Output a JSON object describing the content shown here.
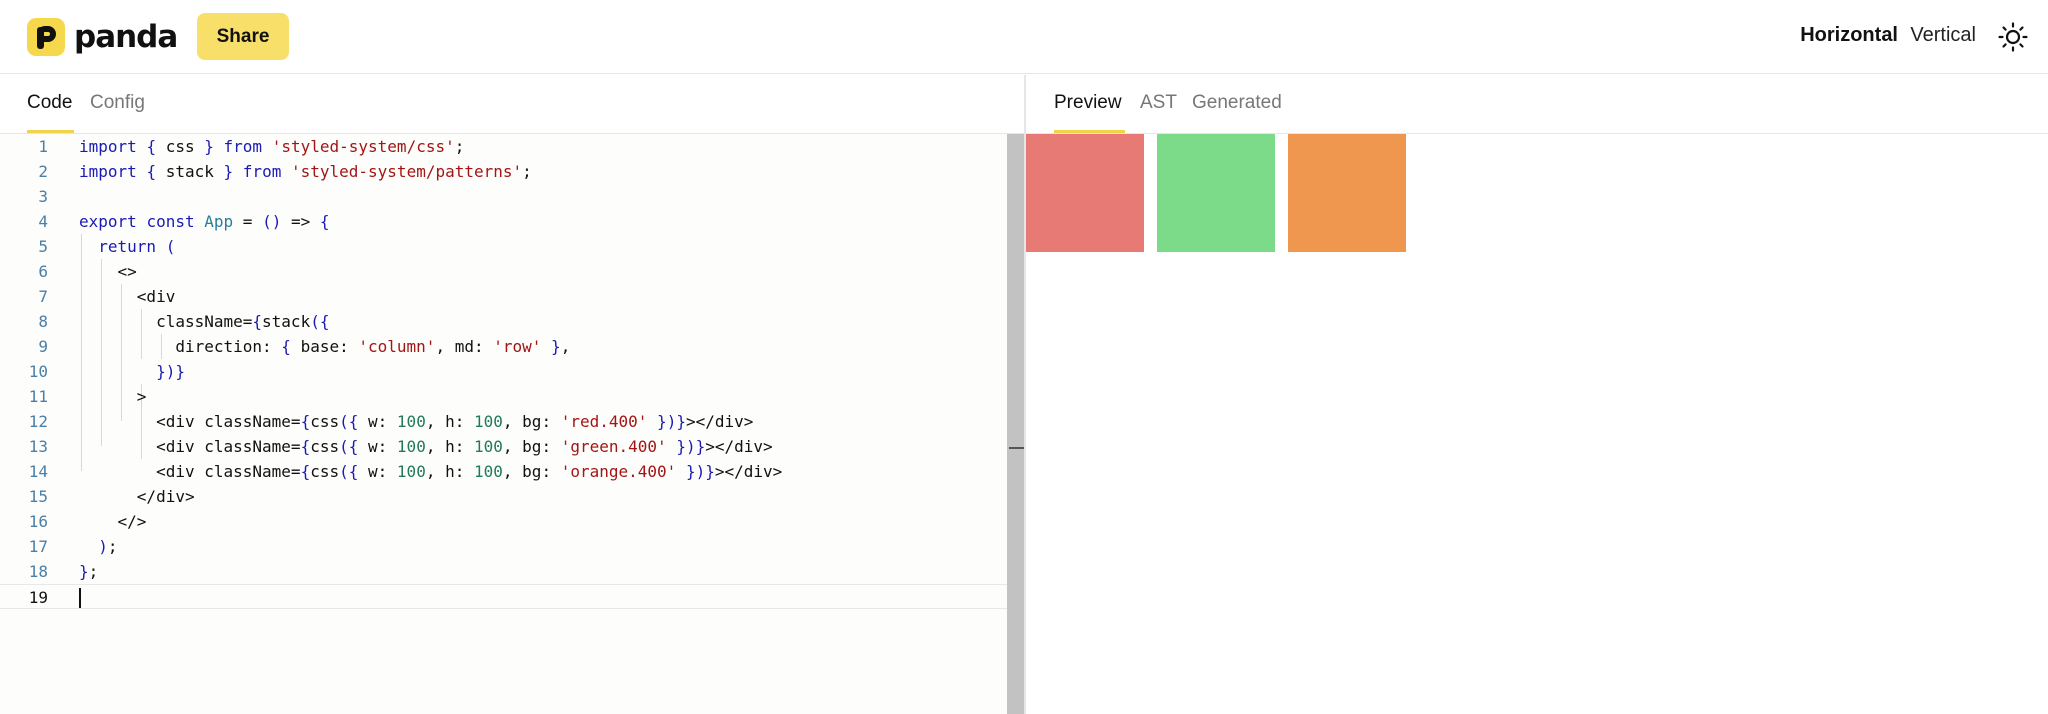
{
  "header": {
    "logo_text": "panda",
    "share_label": "Share",
    "layout_horizontal": "Horizontal",
    "layout_vertical": "Vertical",
    "theme_icon": "sun-icon"
  },
  "editor_tabs": [
    {
      "label": "Code",
      "active": true
    },
    {
      "label": "Config",
      "active": false
    }
  ],
  "preview_tabs": [
    {
      "label": "Preview",
      "active": true
    },
    {
      "label": "AST",
      "active": false
    },
    {
      "label": "Generated",
      "active": false
    }
  ],
  "code_lines": [
    {
      "n": "1",
      "text": "import { css } from 'styled-system/css';"
    },
    {
      "n": "2",
      "text": "import { stack } from 'styled-system/patterns';"
    },
    {
      "n": "3",
      "text": ""
    },
    {
      "n": "4",
      "text": "export const App = () => {"
    },
    {
      "n": "5",
      "text": "  return ("
    },
    {
      "n": "6",
      "text": "    <>"
    },
    {
      "n": "7",
      "text": "      <div"
    },
    {
      "n": "8",
      "text": "        className={stack({"
    },
    {
      "n": "9",
      "text": "          direction: { base: 'column', md: 'row' },"
    },
    {
      "n": "10",
      "text": "        })}"
    },
    {
      "n": "11",
      "text": "      >"
    },
    {
      "n": "12",
      "text": "        <div className={css({ w: 100, h: 100, bg: 'red.400' })}></div>"
    },
    {
      "n": "13",
      "text": "        <div className={css({ w: 100, h: 100, bg: 'green.400' })}></div>"
    },
    {
      "n": "14",
      "text": "        <div className={css({ w: 100, h: 100, bg: 'orange.400' })}></div>"
    },
    {
      "n": "15",
      "text": "      </div>"
    },
    {
      "n": "16",
      "text": "    </>"
    },
    {
      "n": "17",
      "text": "  );"
    },
    {
      "n": "18",
      "text": "};"
    },
    {
      "n": "19",
      "text": ""
    }
  ],
  "current_line": "19",
  "preview_boxes": [
    {
      "name": "red.400",
      "color": "#e77a74"
    },
    {
      "name": "green.400",
      "color": "#7bdb88"
    },
    {
      "name": "orange.400",
      "color": "#ef974f"
    }
  ],
  "colors": {
    "accent": "#f7df6a",
    "tab_underline": "#f0d34a"
  }
}
